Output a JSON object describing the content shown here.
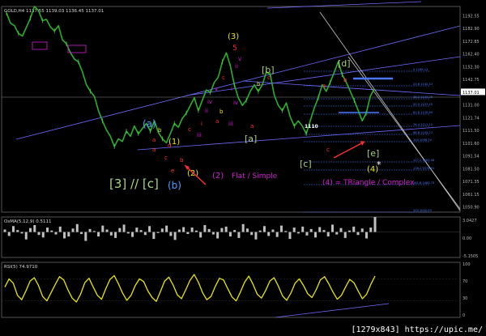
{
  "symbol_header": "GOLD,H4 1137.55 1139.03 1136.45 1137.01",
  "osma_header": "OsMA(5,12,9) 0.5111",
  "rsi_header": "RSI(5) 74.9710",
  "watermark": "[1279x843] https://upic.me/",
  "price_axis_labels": [
    "1192.55",
    "1182.90",
    "1172.85",
    "1162.40",
    "1152.30",
    "1142.75",
    "1137.01",
    "1131.00",
    "1121.74",
    "1111.50",
    "1101.60",
    "1091.54",
    "1081.50",
    "1071.35",
    "1061.15",
    "1050.90"
  ],
  "osma_axis_labels": [
    "3.0427",
    "0.00",
    "-5.1505"
  ],
  "rsi_axis_labels": [
    "100",
    "70",
    "30",
    "0"
  ],
  "fib_levels": [
    "0  1169.13",
    "23.6  1142.43",
    "38.2  1134.26",
    "50.0  1127.45",
    "61.8  1120.89",
    "76.4  1111.12",
    "88.6  1105.27",
    "100  1098.70",
    "127.2  1083.08",
    "138.2  1076.91",
    "161.8  1063.73",
    "200  1042.50"
  ],
  "wave_labels": {
    "w3c": "[3] // [c]",
    "a_paren": "(a)",
    "b_paren": "(b)",
    "w1": "(1)",
    "w2": "(2)",
    "w2_note": "Flat / Simple",
    "w3": "(3)",
    "w4": "(4)",
    "w4_note": "(4) = TRiangle / Complex",
    "a_br": "[a]",
    "b_br": "[b]",
    "c_br": "[c]",
    "d_br": "[d]",
    "e_br": "[e]",
    "level_1110": "1110",
    "small": [
      "a",
      "b",
      "c",
      "d",
      "e",
      "a",
      "b",
      "c",
      "i",
      "ii",
      "iii",
      "iv",
      "v",
      "a",
      "b",
      "c",
      "i",
      "ii",
      "iii",
      "iv",
      "v",
      "a",
      "b",
      "c",
      "a",
      "b",
      "c",
      "5"
    ]
  },
  "colors": {
    "price_line": "#2eae2e",
    "up": "#49d049",
    "trend_lines": "#6f6cff",
    "fib": "#4a78ff",
    "rsi": "#e7e70f",
    "osma": "#c0c0c0",
    "wave_red": "#ff3030",
    "wave_yellow": "#e7e70f",
    "wave_green": "#a8d27f",
    "wave_blue": "#4aa0ff",
    "wave_magenta": "#d21fd2",
    "white_channel": "#c8c8c8"
  },
  "chart_data": [
    {
      "type": "line",
      "title": "GOLD,H4",
      "series": [
        {
          "name": "GOLD",
          "values": [
            1196,
            1188,
            1186,
            1180,
            1178,
            1185,
            1192,
            1201,
            1198,
            1190,
            1191,
            1185,
            1182,
            1186,
            1175,
            1172,
            1165,
            1160,
            1158,
            1150,
            1140,
            1135,
            1131,
            1120,
            1112,
            1105,
            1100,
            1092,
            1098,
            1096,
            1104,
            1100,
            1108,
            1102,
            1106,
            1110,
            1104,
            1112,
            1103,
            1098,
            1095,
            1102,
            1110,
            1107,
            1114,
            1118,
            1124,
            1130,
            1120,
            1128,
            1136,
            1134,
            1142,
            1146,
            1158,
            1165,
            1155,
            1140,
            1130,
            1124,
            1128,
            1135,
            1140,
            1135,
            1140,
            1150,
            1148,
            1132,
            1124,
            1120,
            1126,
            1115,
            1108,
            1112,
            1108,
            1102,
            1112,
            1122,
            1130,
            1140,
            1135,
            1142,
            1150,
            1158,
            1148,
            1142,
            1135,
            1128,
            1120,
            1112,
            1118,
            1131,
            1137
          ]
        }
      ],
      "ylim": [
        1041,
        1201
      ]
    },
    {
      "type": "bar",
      "title": "OsMA(5,12,9)",
      "values": [
        0.5,
        -0.8,
        1.2,
        0.4,
        -0.3,
        -1.5,
        0.8,
        1.4,
        -0.6,
        -1.1,
        0.9,
        0.3,
        -0.5,
        1.1,
        -1.3,
        -0.9,
        0.7,
        1.6,
        -0.4,
        -1.8,
        0.6,
        0.2,
        -0.9,
        1.3,
        0.5,
        -0.7,
        -1.2,
        0.8,
        1.5,
        -0.3,
        -1.0,
        0.9,
        0.4,
        -0.6,
        1.2,
        -1.4,
        -0.2,
        0.7,
        1.3,
        -0.8,
        -1.6,
        0.5,
        1.0,
        -0.4,
        0.9,
        0.3,
        -1.1,
        1.4,
        0.6,
        -0.5,
        -1.3,
        0.8,
        1.1,
        -0.9,
        0.4,
        -1.2,
        1.6,
        0.7,
        -0.6,
        -1.5,
        0.3,
        1.2,
        -0.8,
        0.5,
        -1.0,
        1.3,
        0.2,
        -1.4,
        0.9,
        -0.3,
        1.1,
        -0.7,
        0.6,
        -1.1,
        1.0,
        0.4,
        -0.9,
        1.5,
        -0.5,
        0.8,
        -1.2,
        0.3,
        1.1,
        -0.6,
        0.7,
        -1.3,
        0.9,
        3.04
      ],
      "ylim": [
        -5.1505,
        3.0427
      ]
    },
    {
      "type": "line",
      "title": "RSI(5)",
      "series": [
        {
          "name": "RSI(5)",
          "values": [
            55,
            70,
            62,
            40,
            32,
            48,
            66,
            72,
            58,
            38,
            30,
            45,
            60,
            74,
            68,
            50,
            35,
            28,
            42,
            63,
            71,
            55,
            40,
            33,
            52,
            69,
            76,
            61,
            44,
            31,
            40,
            58,
            70,
            65,
            48,
            36,
            29,
            47,
            66,
            73,
            59,
            41,
            34,
            50,
            67,
            78,
            64,
            45,
            32,
            38,
            56,
            71,
            68,
            52,
            37,
            30,
            46,
            64,
            75,
            60,
            42,
            35,
            49,
            66,
            72,
            57,
            39,
            31,
            44,
            62,
            70,
            58,
            43,
            36,
            50,
            68,
            74,
            61,
            46,
            33,
            40,
            55,
            69,
            63,
            48,
            34,
            42,
            60,
            74.97
          ]
        }
      ],
      "ylim": [
        0,
        100
      ]
    }
  ]
}
